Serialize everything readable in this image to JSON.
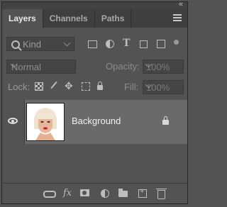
{
  "panel": {
    "collapse_glyph": "«",
    "tabs": [
      {
        "label": "Layers",
        "active": true
      },
      {
        "label": "Channels",
        "active": false
      },
      {
        "label": "Paths",
        "active": false
      }
    ],
    "menu_icon": "panel-menu-icon"
  },
  "filter": {
    "kind_label": "Kind",
    "icons": [
      "pixel-layer-filter-icon",
      "adjustment-layer-filter-icon",
      "type-layer-filter-icon",
      "shape-layer-filter-icon",
      "smart-object-filter-icon"
    ]
  },
  "blend": {
    "mode": "Normal",
    "opacity_label": "Opacity:",
    "opacity_value": "100%"
  },
  "lock": {
    "label": "Lock:",
    "fill_label": "Fill:",
    "fill_value": "100%"
  },
  "layers": [
    {
      "name": "Background",
      "visible": true,
      "locked": true
    }
  ],
  "bottom_icons": [
    "link-layers-icon",
    "layer-style-icon",
    "add-mask-icon",
    "new-adjustment-icon",
    "new-group-icon",
    "new-layer-icon",
    "delete-layer-icon"
  ],
  "colors": {
    "panel_bg": "#535353",
    "selected_layer_bg": "#6a6a6a",
    "tab_bar_bg": "#3f3f3f"
  }
}
